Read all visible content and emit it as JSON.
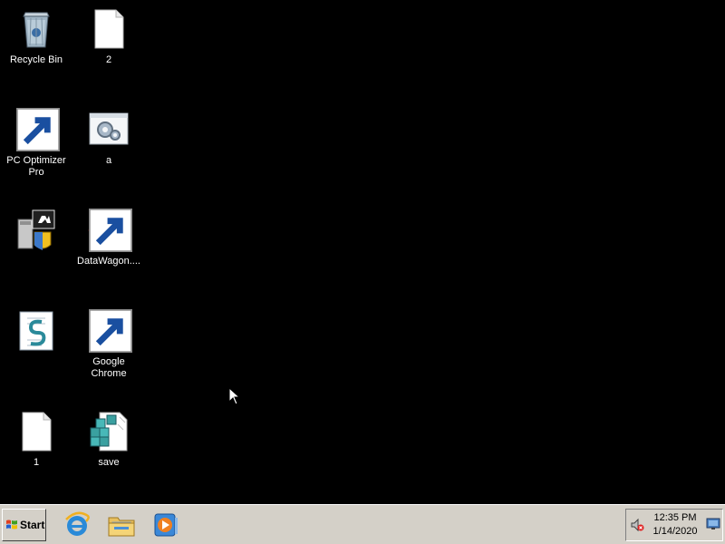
{
  "desktop": {
    "icons": {
      "recycle_bin": {
        "label": "Recycle Bin",
        "icon": "recycle-bin-icon"
      },
      "file_2": {
        "label": "2",
        "icon": "blank-file-icon"
      },
      "pc_optimizer": {
        "label": "PC Optimizer Pro",
        "icon": "pc-optimizer-icon"
      },
      "a": {
        "label": "a",
        "icon": "settings-file-icon"
      },
      "installer": {
        "label": "",
        "icon": "installer-icon"
      },
      "datawagon": {
        "label": "DataWagon....",
        "icon": "datawagon-icon"
      },
      "script": {
        "label": "",
        "icon": "script-icon"
      },
      "chrome": {
        "label": "Google Chrome",
        "icon": "chrome-icon"
      },
      "file_1": {
        "label": "1",
        "icon": "blank-file-icon"
      },
      "save": {
        "label": "save",
        "icon": "registry-file-icon"
      }
    }
  },
  "taskbar": {
    "start_label": "Start",
    "quick_launch": [
      "internet-explorer-icon",
      "file-explorer-icon",
      "media-player-icon"
    ],
    "tray": {
      "time": "12:35 PM",
      "date": "1/14/2020",
      "volume_icon": "volume-muted-icon",
      "show_desktop_icon": "show-desktop-icon"
    }
  },
  "colors": {
    "desktop_background": "#000000",
    "taskbar_background": "#d4d0c8",
    "label_text": "#ffffff"
  }
}
